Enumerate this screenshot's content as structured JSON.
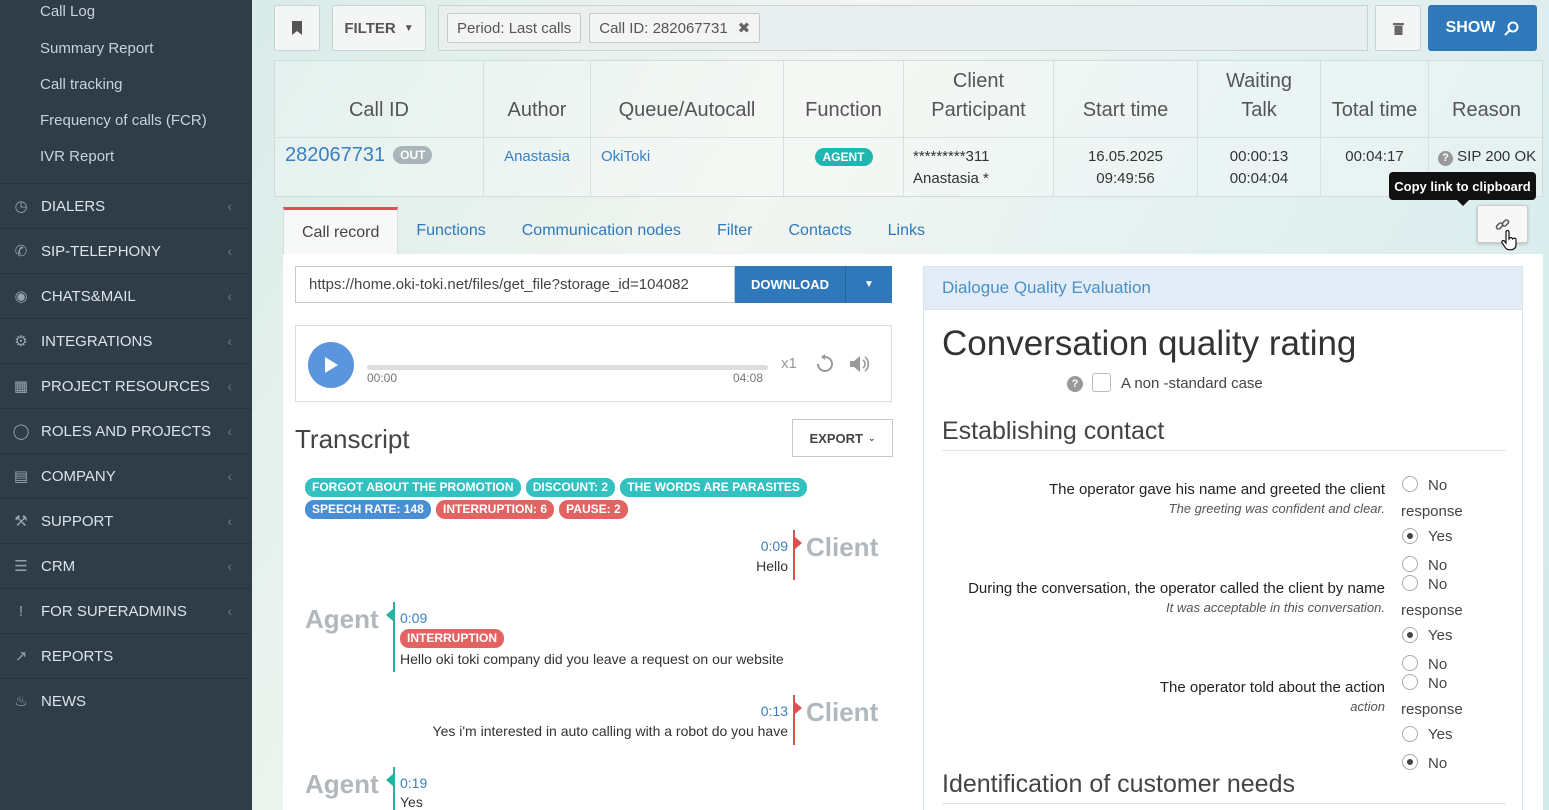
{
  "sidebar": {
    "subitems": [
      "Call Log",
      "Summary Report",
      "Call tracking",
      "Frequency of calls (FCR)",
      "IVR Report"
    ],
    "sections": [
      {
        "label": "DIALERS",
        "icon": "clock-icon"
      },
      {
        "label": "SIP-TELEPHONY",
        "icon": "phone-icon"
      },
      {
        "label": "CHATS&MAIL",
        "icon": "chat-icon"
      },
      {
        "label": "INTEGRATIONS",
        "icon": "gears-icon"
      },
      {
        "label": "PROJECT RESOURCES",
        "icon": "grid-icon"
      },
      {
        "label": "ROLES AND PROJECTS",
        "icon": "toggle-icon"
      },
      {
        "label": "COMPANY",
        "icon": "bar-chart-icon"
      },
      {
        "label": "SUPPORT",
        "icon": "wrench-icon"
      },
      {
        "label": "CRM",
        "icon": "list-icon"
      },
      {
        "label": "FOR SUPERADMINS",
        "icon": "exclamation-icon"
      },
      {
        "label": "REPORTS",
        "icon": "line-chart-icon"
      },
      {
        "label": "NEWS",
        "icon": "bell-icon"
      }
    ]
  },
  "filter": {
    "filter_label": "FILTER",
    "chips": [
      "Period: Last calls",
      "Call ID: 282067731"
    ],
    "show_label": "SHOW"
  },
  "table": {
    "headers": {
      "call_id": "Call ID",
      "author": "Author",
      "queue": "Queue/Autocall",
      "function": "Function",
      "client_1": "Client",
      "client_2": "Participant",
      "start": "Start time",
      "wait_1": "Waiting",
      "wait_2": "Talk",
      "total": "Total time",
      "reason": "Reason"
    },
    "row": {
      "call_id": "282067731",
      "direction": "OUT",
      "author": "Anastasia",
      "queue": "OkiToki",
      "function": "AGENT",
      "client_1": "*********311",
      "client_2": "Anastasia *",
      "start_date": "16.05.2025",
      "start_time": "09:49:56",
      "waiting": "00:00:13",
      "talk": "00:04:04",
      "total": "00:04:17",
      "reason": "SIP 200 OK"
    }
  },
  "tooltip": "Copy link to clipboard",
  "tabs": [
    "Call record",
    "Functions",
    "Communication nodes",
    "Filter",
    "Contacts",
    "Links"
  ],
  "record": {
    "url": "https://home.oki-toki.net/files/get_file?storage_id=104082",
    "download_label": "DOWNLOAD",
    "time_current": "00:00",
    "time_total": "04:08",
    "speed": "x1"
  },
  "transcript": {
    "title": "Transcript",
    "export_label": "EXPORT",
    "tags": [
      {
        "text": "FORGOT ABOUT THE PROMOTION",
        "color": "#33c0c0"
      },
      {
        "text": "DISCOUNT: 2",
        "color": "#33c0c0"
      },
      {
        "text": "THE WORDS ARE PARASITES",
        "color": "#33c0c0"
      },
      {
        "text": "SPEECH RATE: 148",
        "color": "#4a8fd6"
      },
      {
        "text": "INTERRUPTION: 6",
        "color": "#e36363"
      },
      {
        "text": "PAUSE: 2",
        "color": "#e36363"
      }
    ],
    "messages": [
      {
        "who": "Client",
        "time": "0:09",
        "text": "Hello"
      },
      {
        "who": "Agent",
        "time": "0:09",
        "tag": "INTERRUPTION",
        "text": "Hello oki toki company did you leave a request on our website"
      },
      {
        "who": "Client",
        "time": "0:13",
        "text": "Yes i'm interested in auto calling with a robot do you have"
      },
      {
        "who": "Agent",
        "time": "0:19",
        "text": "Yes"
      }
    ]
  },
  "dqe": {
    "header": "Dialogue Quality Evaluation",
    "title": "Conversation quality rating",
    "nonstandard": "A non -standard case",
    "section1": "Establishing contact",
    "section2": "Identification of customer needs",
    "questions": [
      {
        "q": "The operator gave his name and greeted the client",
        "sub": "The greeting was confident and clear.",
        "opt1": "No",
        "opt1b": "response",
        "opt2": "Yes",
        "opt3": "No",
        "selected": "Yes"
      },
      {
        "q": "During the conversation, the operator called the client by name",
        "sub": "It was acceptable in this conversation.",
        "opt1": "No",
        "opt1b": "response",
        "opt2": "Yes",
        "opt3": "No",
        "selected": "Yes"
      },
      {
        "q": "The operator told about the action",
        "sub": "action",
        "opt1": "No",
        "opt1b": "response",
        "opt2": "Yes",
        "opt3": "No",
        "selected": "No"
      }
    ]
  }
}
